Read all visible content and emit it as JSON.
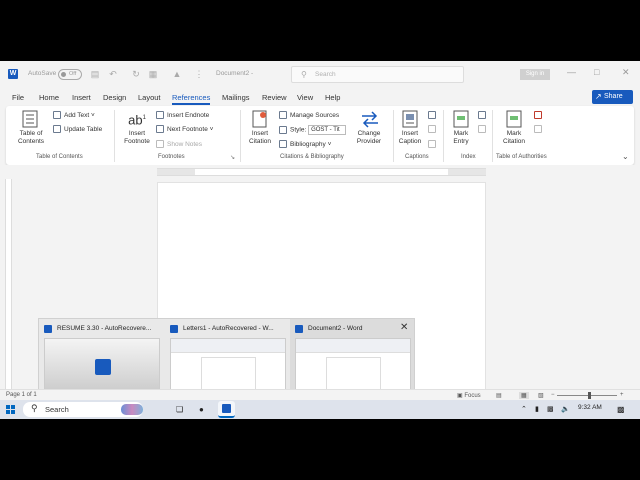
{
  "titlebar": {
    "autosave_label": "AutoSave",
    "autosave_state": "Off",
    "doc_title": "Document2 -",
    "search_placeholder": "Search",
    "signin_label": "Sign in"
  },
  "menu": {
    "items": [
      "File",
      "Home",
      "Insert",
      "Design",
      "Layout",
      "References",
      "Mailings",
      "Review",
      "View",
      "Help"
    ],
    "active": "References",
    "share_label": "Share"
  },
  "ribbon": {
    "toc": {
      "big_label_1": "Table of",
      "big_label_2": "Contents",
      "add_text": "Add Text",
      "update_table": "Update Table",
      "group": "Table of Contents"
    },
    "footnotes": {
      "big_label_1": "Insert",
      "big_label_2": "Footnote",
      "insert_endnote": "Insert Endnote",
      "next_footnote": "Next Footnote",
      "show_notes": "Show Notes",
      "group": "Footnotes"
    },
    "citations": {
      "insert_citation_1": "Insert",
      "insert_citation_2": "Citation",
      "manage_sources": "Manage Sources",
      "style_label": "Style:",
      "style_value": "GOST - Tit",
      "bibliography": "Bibliography",
      "change_provider_1": "Change",
      "change_provider_2": "Provider",
      "group": "Citations & Bibliography"
    },
    "captions": {
      "insert_caption_1": "Insert",
      "insert_caption_2": "Caption",
      "group": "Captions"
    },
    "index": {
      "mark_entry_1": "Mark",
      "mark_entry_2": "Entry",
      "group": "Index"
    },
    "authorities": {
      "mark_citation_1": "Mark",
      "mark_citation_2": "Citation",
      "group": "Table of Authorities"
    }
  },
  "statusbar": {
    "page": "Page 1 of 1",
    "focus": "Focus"
  },
  "taskbar": {
    "search_label": "Search",
    "time": "9:32 AM"
  },
  "thumbnails": [
    {
      "title": "RESUME 3.30 - AutoRecovere..."
    },
    {
      "title": "Letters1 - AutoRecovered - W..."
    },
    {
      "title": "Document2 - Word"
    }
  ],
  "colors": {
    "accent": "#185abd",
    "taskbar": "#dee3ec"
  }
}
